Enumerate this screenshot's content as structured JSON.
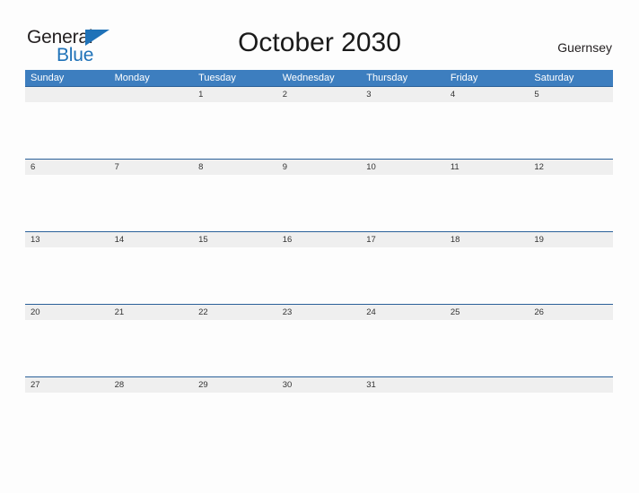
{
  "brand": {
    "name_part1": "General",
    "name_part2": "Blue",
    "colors": {
      "dark": "#231f20",
      "blue": "#1f72b8"
    }
  },
  "header": {
    "title": "October 2030",
    "location": "Guernsey"
  },
  "calendar": {
    "month": "October",
    "year": "2030",
    "accent_color": "#3d7ebf",
    "band_color": "#efefef",
    "row_border_color": "#2a6099",
    "day_names": [
      "Sunday",
      "Monday",
      "Tuesday",
      "Wednesday",
      "Thursday",
      "Friday",
      "Saturday"
    ],
    "weeks": [
      {
        "days": [
          "",
          "",
          "1",
          "2",
          "3",
          "4",
          "5"
        ]
      },
      {
        "days": [
          "6",
          "7",
          "8",
          "9",
          "10",
          "11",
          "12"
        ]
      },
      {
        "days": [
          "13",
          "14",
          "15",
          "16",
          "17",
          "18",
          "19"
        ]
      },
      {
        "days": [
          "20",
          "21",
          "22",
          "23",
          "24",
          "25",
          "26"
        ]
      },
      {
        "days": [
          "27",
          "28",
          "29",
          "30",
          "31",
          "",
          ""
        ]
      }
    ]
  }
}
